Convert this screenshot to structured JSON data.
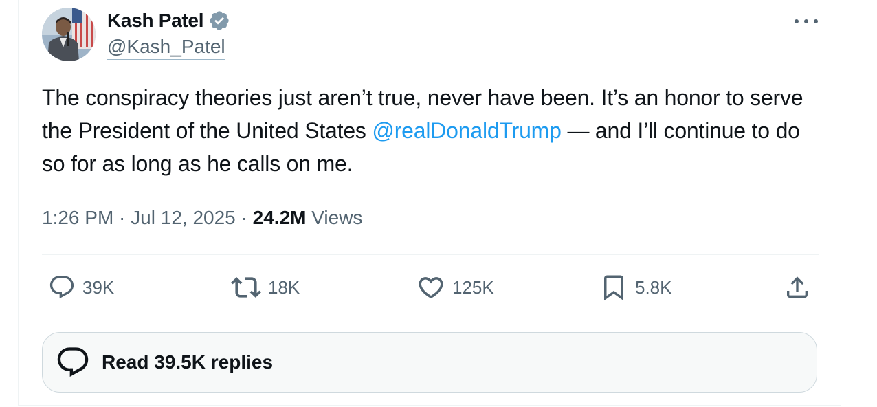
{
  "author": {
    "display_name": "Kash Patel",
    "handle": "@Kash_Patel",
    "verified": true,
    "avatar_icon": "profile-photo"
  },
  "tweet": {
    "text_before_mention": "The conspiracy theories just aren’t true, never have been. It’s an honor to serve the President of the United States ",
    "mention": "@realDonaldTrump",
    "text_after_mention": " — and I’ll continue to do so for as long as he calls on me."
  },
  "meta": {
    "time": "1:26 PM",
    "separator": " · ",
    "date": "Jul 12, 2025",
    "views_count": "24.2M",
    "views_label": " Views"
  },
  "actions": {
    "replies": "39K",
    "reposts": "18K",
    "likes": "125K",
    "bookmarks": "5.8K"
  },
  "read_replies": {
    "label": "Read 39.5K replies"
  },
  "colors": {
    "accent": "#1d9bf0",
    "text": "#0f1419",
    "secondary": "#536471",
    "verified_badge": "#829aab"
  },
  "icons": [
    "verified-badge-icon",
    "more-icon",
    "reply-icon",
    "repost-icon",
    "like-icon",
    "bookmark-icon",
    "share-icon",
    "reply-bubble-icon"
  ]
}
